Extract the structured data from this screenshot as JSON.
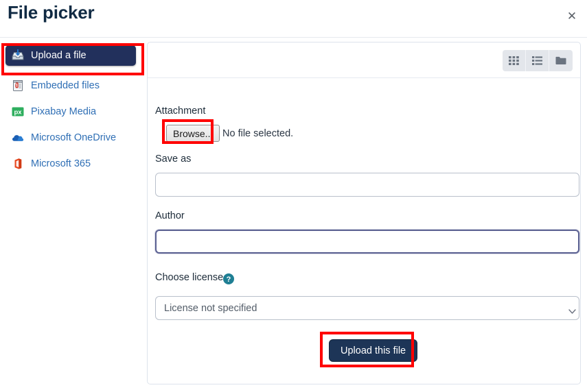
{
  "window": {
    "title": "File picker",
    "close_label": "✕"
  },
  "sidebar": {
    "items": [
      {
        "label": "Upload a file",
        "icon": "upload-tray-icon",
        "active": true
      },
      {
        "label": "Embedded files",
        "icon": "embedded-files-icon",
        "active": false
      },
      {
        "label": "Pixabay Media",
        "icon": "pixabay-icon",
        "active": false
      },
      {
        "label": "Microsoft OneDrive",
        "icon": "onedrive-cloud-icon",
        "active": false
      },
      {
        "label": "Microsoft 365",
        "icon": "microsoft-365-icon",
        "active": false
      }
    ]
  },
  "toolbar": {
    "view_buttons": [
      {
        "name": "grid-view-icon",
        "title": "Display folder with file icons"
      },
      {
        "name": "list-view-icon",
        "title": "Display folder with file details"
      },
      {
        "name": "folder-view-icon",
        "title": "Display folder as file tree"
      }
    ]
  },
  "form": {
    "attachment": {
      "label": "Attachment",
      "browse_label": "Browse...",
      "file_status": "No file selected."
    },
    "save_as": {
      "label": "Save as",
      "value": "",
      "placeholder": ""
    },
    "author": {
      "label": "Author",
      "value": "",
      "placeholder": "",
      "focused": true
    },
    "license": {
      "label": "Choose license",
      "help_icon": "help-circle-icon",
      "selected": "License not specified",
      "options": [
        "License not specified"
      ]
    },
    "submit": {
      "label": "Upload this file"
    }
  },
  "colors": {
    "title": "#102a43",
    "accent_dark": "#1d3557",
    "sidebar_active_bg": "#22305c",
    "link": "#2f6fb5",
    "annotation": "#ff0000",
    "focus_border": "#5b6192",
    "panel_border": "#dde3ec"
  }
}
